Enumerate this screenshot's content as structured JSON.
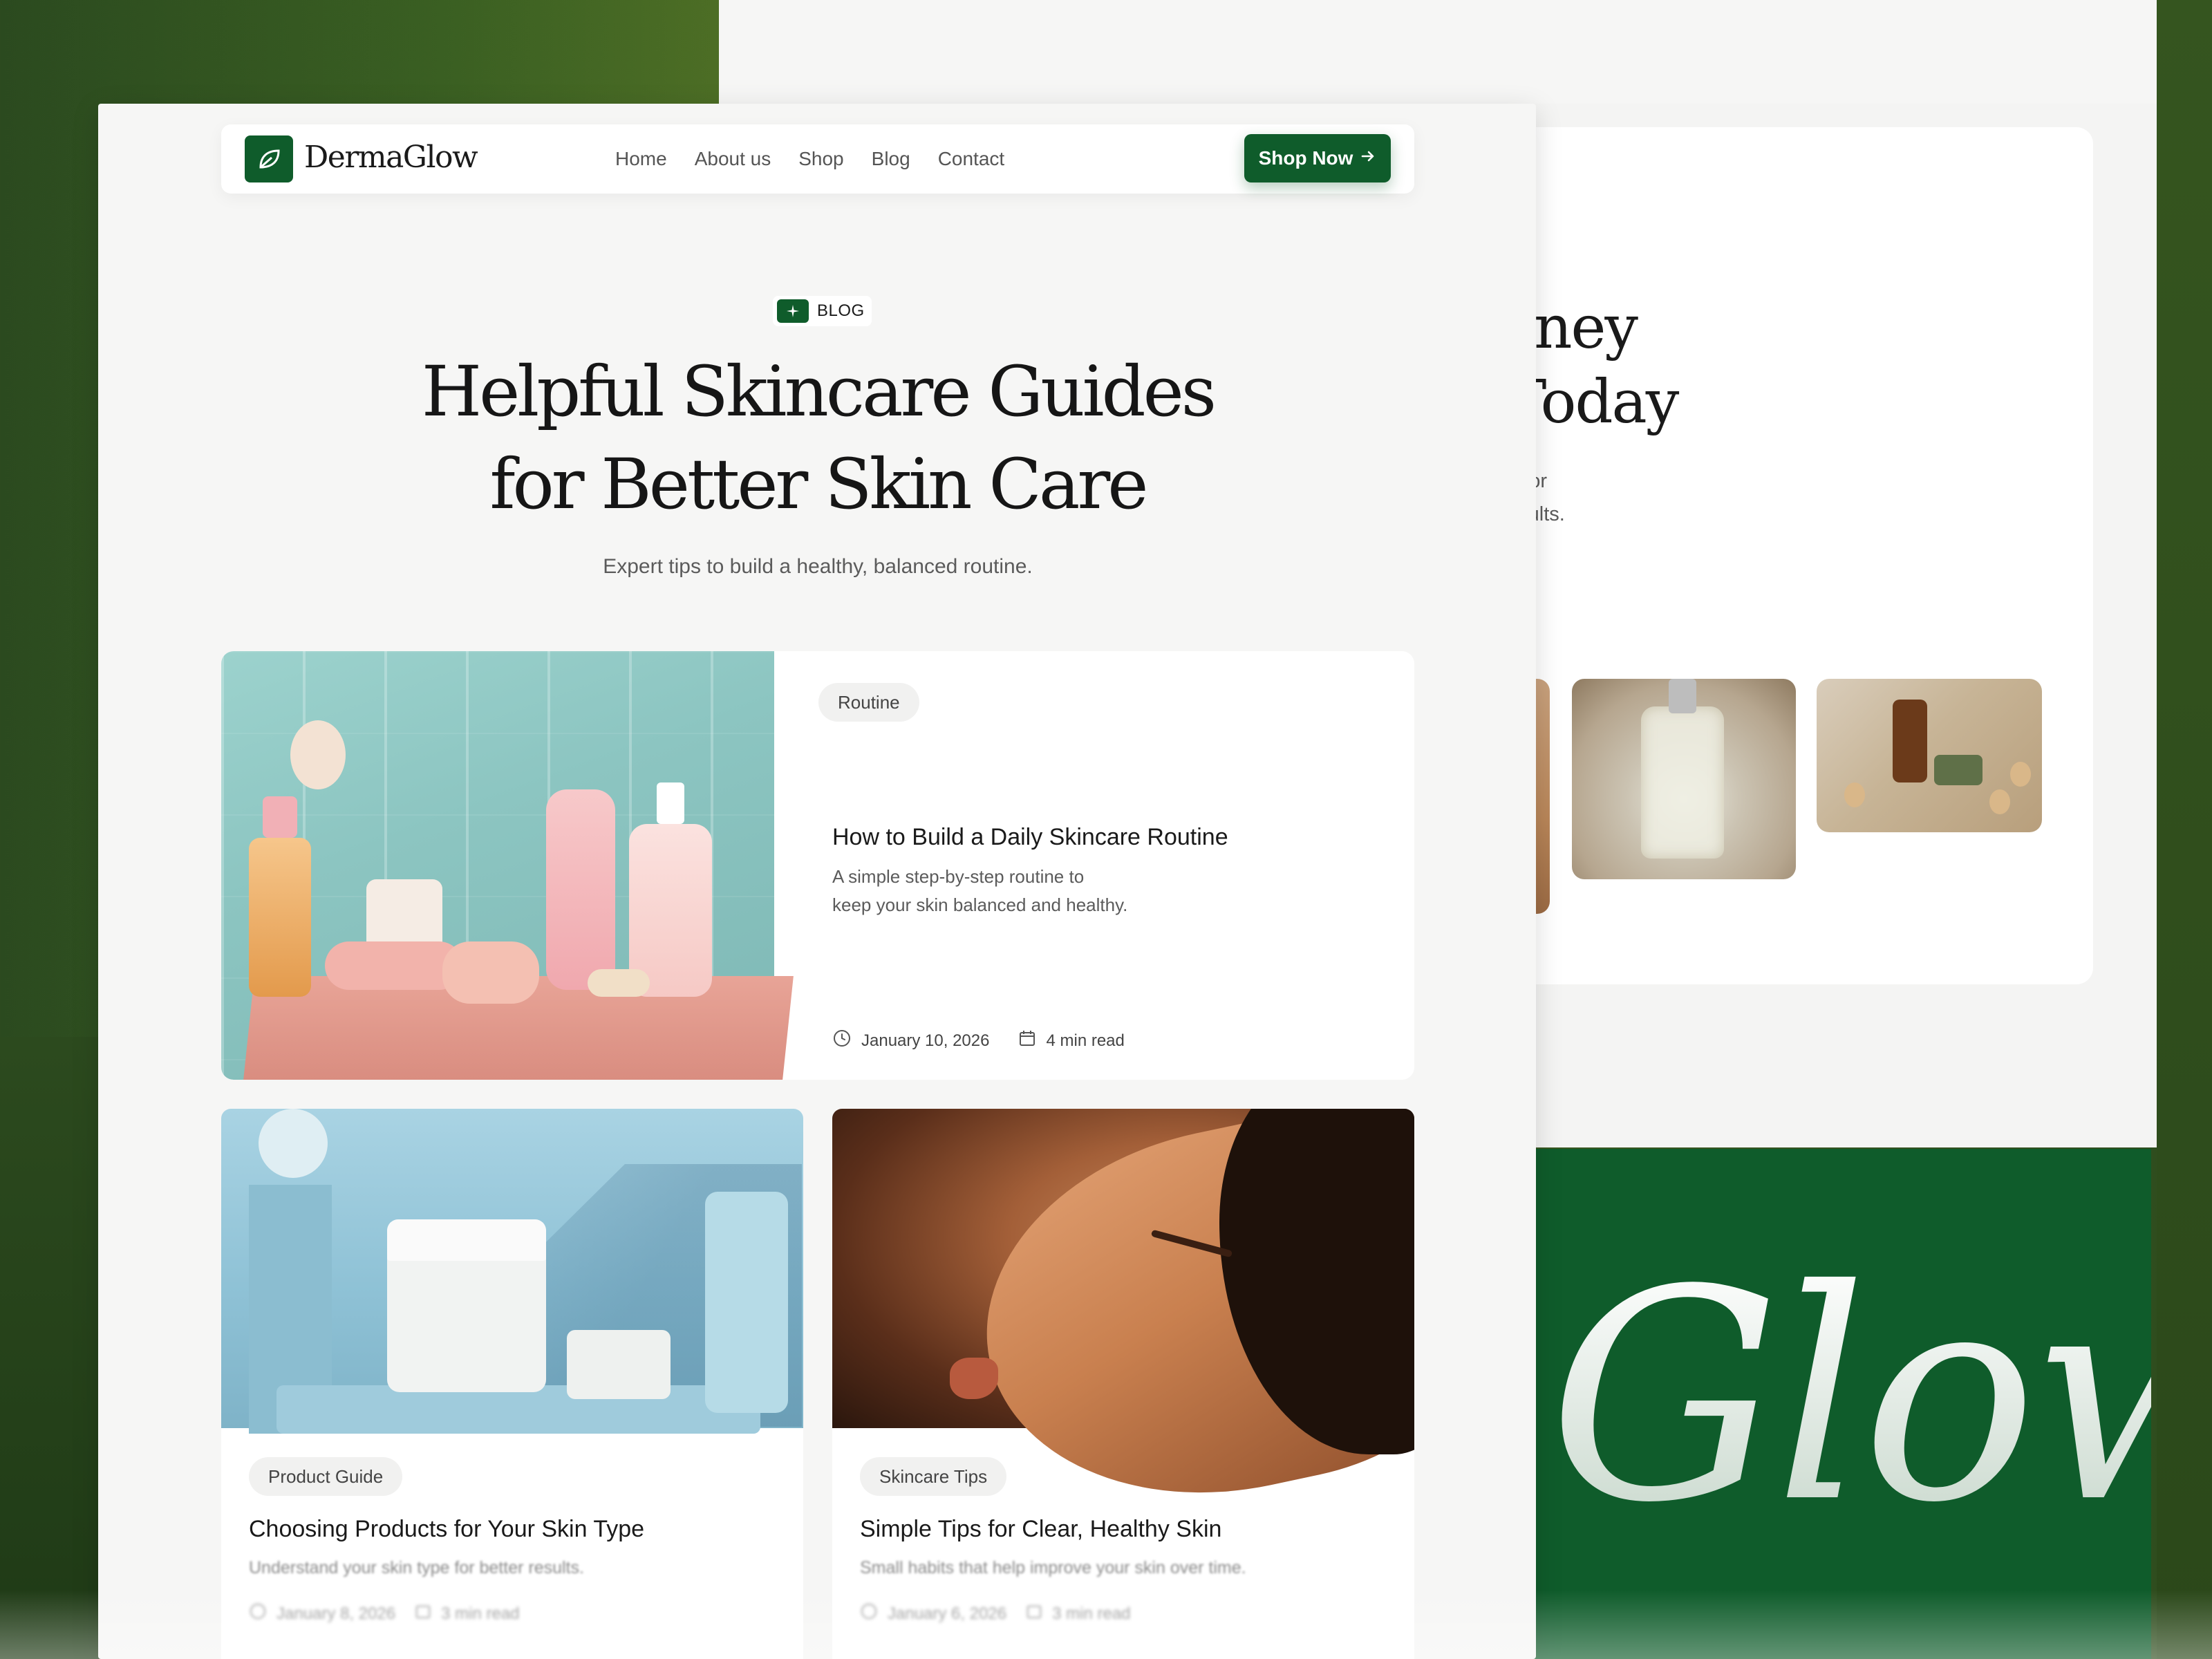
{
  "brand": {
    "name": "DermaGlow"
  },
  "nav": {
    "links": [
      "Home",
      "About us",
      "Shop",
      "Blog",
      "Contact"
    ],
    "cta": "Shop Now"
  },
  "hero": {
    "badge": "BLOG",
    "title_line1": "Helpful Skincare Guides",
    "title_line2": "for Better Skin Care",
    "subtitle": "Expert tips to build a healthy, balanced routine."
  },
  "featured": {
    "tag": "Routine",
    "title": "How to Build a Daily Skincare Routine",
    "desc_line1": "A simple step-by-step routine to",
    "desc_line2": "keep your skin balanced and healthy.",
    "date": "January 10, 2026",
    "read_time": "4 min read"
  },
  "cards": [
    {
      "tag": "Product Guide",
      "title": "Choosing Products for Your Skin Type",
      "desc": "Understand your skin type for better results.",
      "date": "January 8, 2026",
      "read_time": "3 min read"
    },
    {
      "tag": "Skincare Tips",
      "title": "Simple Tips for Clear, Healthy Skin",
      "desc": "Small habits that help improve your skin over time.",
      "date": "January 6, 2026",
      "read_time": "3 min read"
    }
  ],
  "background_page": {
    "heading_line1": "rney",
    "heading_line2": "Today",
    "sub_line1": "d for",
    "sub_line2": "esults.",
    "glow_word": "Glow"
  },
  "colors": {
    "brand_green": "#0f5c2b",
    "page_bg": "#f6f6f5",
    "outer_bg": "#3a5f22"
  },
  "icons": {
    "logo": "leaf-icon",
    "cta": "arrow-right-icon",
    "badge": "sparkle-icon",
    "date": "clock-icon",
    "read_time": "calendar-icon"
  }
}
